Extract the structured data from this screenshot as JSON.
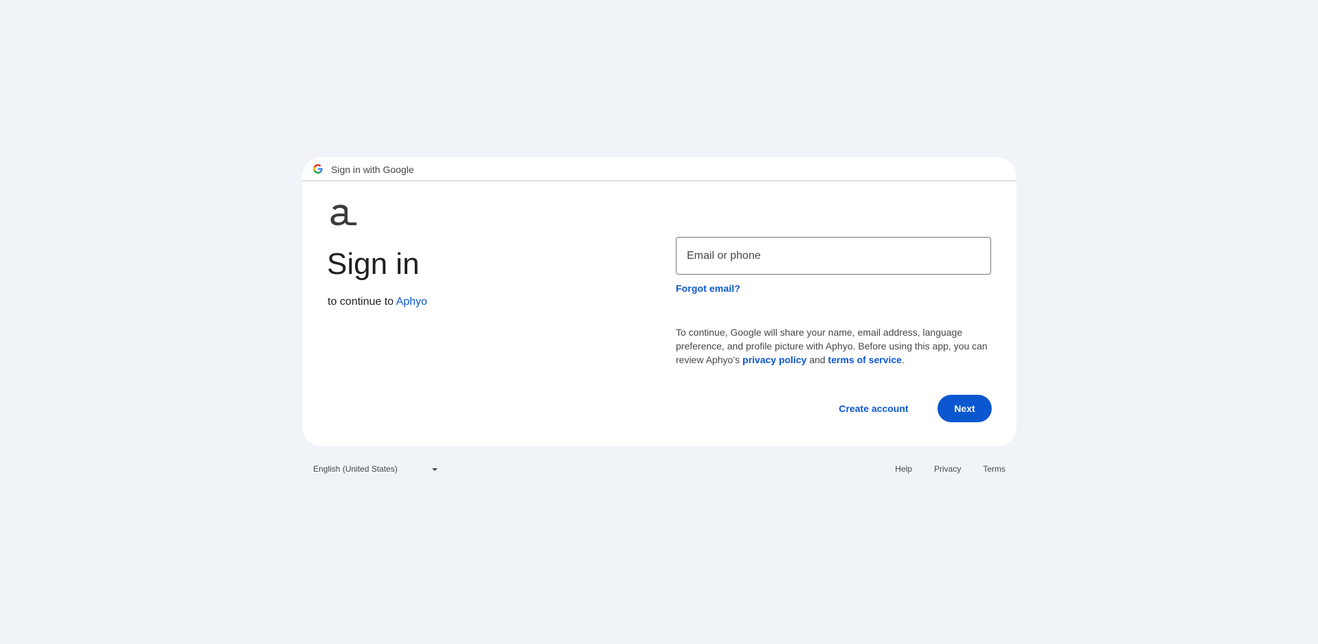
{
  "header": {
    "title": "Sign in with Google",
    "logo_icon": "google-g-icon"
  },
  "app": {
    "logo_icon": "aphyo-logo-icon"
  },
  "main": {
    "heading": "Sign in",
    "subtitle_prefix": "to continue to ",
    "app_name": "Aphyo"
  },
  "form": {
    "email_placeholder": "Email or phone",
    "email_value": "",
    "forgot_email_label": "Forgot email?"
  },
  "disclaimer": {
    "text_1": "To continue, Google will share your name, email address, language preference, and profile picture with Aphyo. Before using this app, you can review Aphyo’s ",
    "privacy_label": "privacy policy",
    "text_2": " and ",
    "terms_label": "terms of service",
    "text_3": "."
  },
  "actions": {
    "create_account_label": "Create account",
    "next_label": "Next"
  },
  "footer": {
    "language": "English (United States)",
    "links": [
      "Help",
      "Privacy",
      "Terms"
    ]
  },
  "colors": {
    "background": "#f0f4f9",
    "primary": "#0b57d0",
    "card": "#ffffff"
  }
}
